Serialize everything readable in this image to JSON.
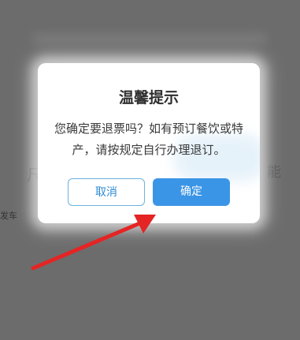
{
  "background": {
    "left_hint": "尺",
    "left_small": "发车",
    "right_hint": "能"
  },
  "dialog": {
    "title": "温馨提示",
    "message": "您确定要退票吗？如有预订餐饮或特产，请按规定自行办理退订。",
    "cancel_label": "取消",
    "confirm_label": "确定"
  },
  "annotation": {
    "arrow_color": "#e52424"
  }
}
